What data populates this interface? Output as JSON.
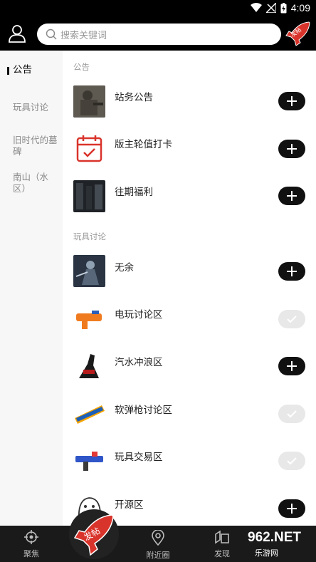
{
  "status_bar": {
    "time": "4:09"
  },
  "header": {
    "search_placeholder": "搜索关键词",
    "post_badge_label": "发帖"
  },
  "left_nav": {
    "items": [
      {
        "label": "公告",
        "active": true
      },
      {
        "label": "玩具讨论",
        "active": false
      },
      {
        "label": "旧时代的墓碑",
        "active": false
      },
      {
        "label": "南山（水区）",
        "active": false
      }
    ]
  },
  "sections": [
    {
      "title": "公告",
      "rows": [
        {
          "label": "站务公告",
          "state": "add",
          "icon": "soldier-photo"
        },
        {
          "label": "版主轮值打卡",
          "state": "add",
          "icon": "calendar-check-icon"
        },
        {
          "label": "往期福利",
          "state": "add",
          "icon": "dark-room-photo"
        }
      ]
    },
    {
      "title": "玩具讨论",
      "rows": [
        {
          "label": "无余",
          "state": "add",
          "icon": "armored-figure-photo"
        },
        {
          "label": "电玩讨论区",
          "state": "added",
          "icon": "orange-blaster-photo"
        },
        {
          "label": "汽水冲浪区",
          "state": "add",
          "icon": "cola-bottle-photo"
        },
        {
          "label": "软弹枪讨论区",
          "state": "added",
          "icon": "nerf-logo"
        },
        {
          "label": "玩具交易区",
          "state": "added",
          "icon": "blue-blaster-photo"
        },
        {
          "label": "开源区",
          "state": "add",
          "icon": "cartoon-sketch"
        }
      ]
    }
  ],
  "bottom_nav": {
    "items": [
      {
        "label": "聚焦",
        "icon": "crosshair-icon"
      },
      {
        "label": "附近圈",
        "icon": "location-pin-icon"
      },
      {
        "label": "发现",
        "icon": "discover-icon"
      }
    ],
    "fab_label": "发帖"
  },
  "watermark": {
    "line1": "962.NET",
    "line2": "乐游网"
  },
  "colors": {
    "header_bg": "#000000",
    "accent_red": "#d9342b",
    "button_dark": "#111111",
    "button_added": "#e8e8e8"
  }
}
